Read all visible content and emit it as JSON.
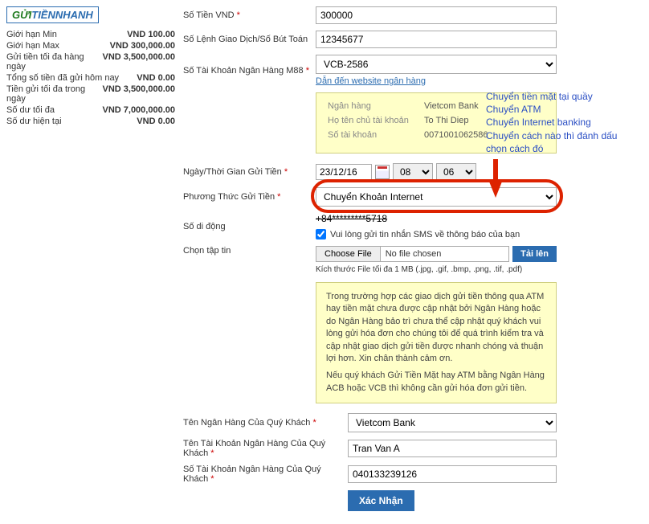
{
  "logo": {
    "prefix": "GỬI",
    "mid": "TIỀN",
    "suffix": "NHANH"
  },
  "sidebar": {
    "items": [
      {
        "label": "Giới hạn Min",
        "value": "VND 100.00"
      },
      {
        "label": "Giới hạn Max",
        "value": "VND 300,000.00"
      },
      {
        "label": "Gửi tiền tối đa hàng ngày",
        "value": "VND 3,500,000.00"
      },
      {
        "label": "Tổng số tiền đã gửi hôm nay",
        "value": "VND 0.00"
      },
      {
        "label": "Tiền gửi tối đa trong ngày",
        "value": "VND 3,500,000.00"
      },
      {
        "label": "Số dư tối đa",
        "value": "VND 7,000,000.00"
      },
      {
        "label": "Số dư hiện tại",
        "value": "VND 0.00"
      }
    ]
  },
  "form": {
    "amount_label": "Số Tiền VND",
    "amount_value": "300000",
    "txn_label": "Số Lệnh Giao Dịch/Số Bút Toán",
    "txn_value": "12345677",
    "bankacc_label": "Số Tài Khoản Ngân Hàng M88",
    "bankacc_value": "VCB-2586",
    "website_link": "Dẫn đến website ngân hàng",
    "date_label": "Ngày/Thời Gian Gửi Tiền",
    "date_value": "23/12/16",
    "hour_value": "08",
    "min_value": "06",
    "method_label": "Phương Thức Gửi Tiền",
    "method_value": "Chuyển Khoản Internet",
    "mobile_label": "Số di động",
    "mobile_value": "+84*********5718",
    "sms_label": "Vui lòng gửi tin nhắn SMS về thông báo của bạn",
    "file_label": "Chọn tập tin",
    "choose_file": "Choose File",
    "no_file": "No file chosen",
    "upload": "Tải lên",
    "file_hint": "Kích thước File tối đa 1 MB (.jpg, .gif, .bmp, .png, .tif, .pdf)",
    "cust_bank_label": "Tên Ngân Hàng Của Quý Khách",
    "cust_bank_value": "Vietcom Bank",
    "cust_name_label": "Tên Tài Khoản Ngân Hàng Của Quý Khách",
    "cust_name_value": "Tran Van A",
    "cust_acc_label": "Số Tài Khoản Ngân Hàng Của Quý Khách",
    "cust_acc_value": "040133239126",
    "submit": "Xác Nhận"
  },
  "bank_box": {
    "r1l": "Ngân hàng",
    "r1v": "Vietcom Bank",
    "r2l": "Họ tên chủ tài khoản",
    "r2v": "To Thi Diep",
    "r3l": "Số tài khoản",
    "r3v": "0071001062586"
  },
  "annotation": {
    "l1": "Chuyển tiền mặt tại quầy",
    "l2": "Chuyển ATM",
    "l3": "Chuyển Internet banking",
    "l4": "Chuyển cách nào thì đánh dấu chọn cách đó"
  },
  "notice": {
    "p1": "Trong trường hợp các giao dịch gửi tiền thông qua ATM hay tiền mặt chưa được cập nhật bởi Ngân Hàng hoặc do Ngân Hàng bảo trì chưa thể cập nhật quý khách vui lòng gửi hóa đơn cho chúng tôi để quá trình kiểm tra và cập nhật giao dịch gửi tiền được nhanh chóng và thuận lợi hơn. Xin chân thành cảm ơn.",
    "p2": "Nếu quý khách Gửi Tiền Mặt hay ATM bằng Ngân Hàng ACB hoặc VCB thì không cần gửi hóa đơn gửi tiền."
  }
}
